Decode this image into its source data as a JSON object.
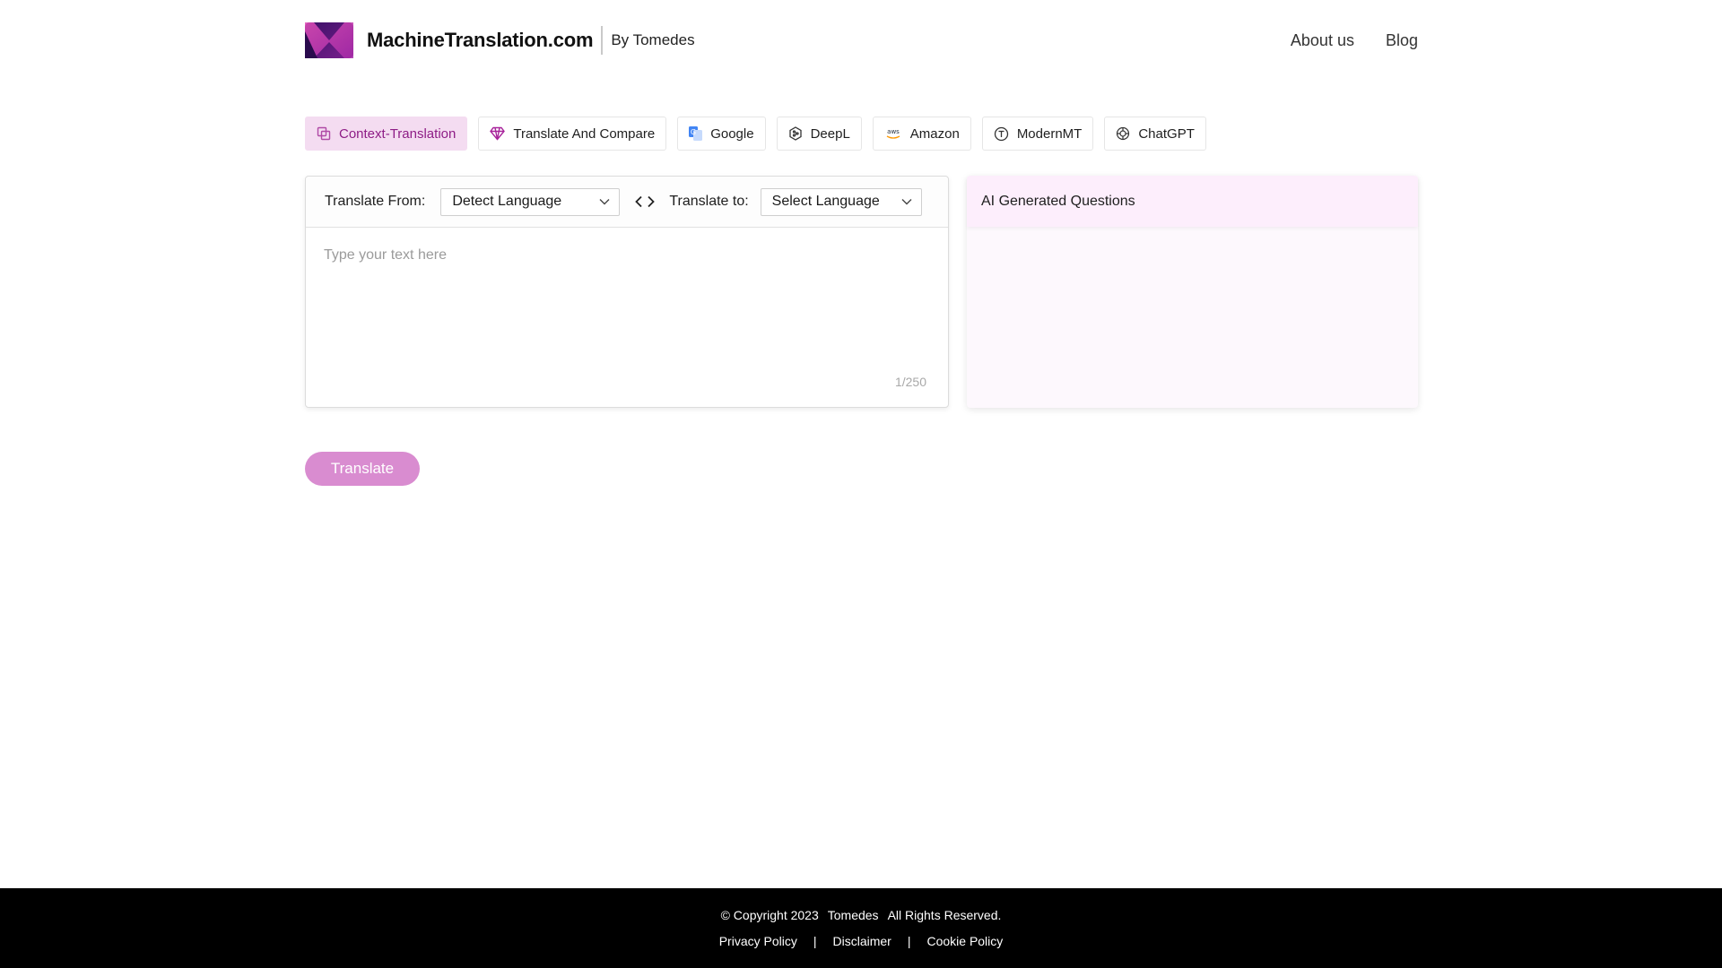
{
  "header": {
    "brand_name": "MachineTranslation.com",
    "brand_by": "By Tomedes",
    "nav": [
      "About us",
      "Blog"
    ]
  },
  "tabs": [
    {
      "label": "Context-Translation",
      "icon": "copy-icon",
      "active": true
    },
    {
      "label": "Translate And Compare",
      "icon": "diamond-icon"
    },
    {
      "label": "Google",
      "icon": "google-translate-icon"
    },
    {
      "label": "DeepL",
      "icon": "deepl-icon"
    },
    {
      "label": "Amazon",
      "icon": "aws-icon"
    },
    {
      "label": "ModernMT",
      "icon": "modernmt-icon"
    },
    {
      "label": "ChatGPT",
      "icon": "chatgpt-icon"
    }
  ],
  "translator": {
    "from_label": "Translate From:",
    "from_value": "Detect Language",
    "to_label": "Translate to:",
    "to_value": "Select Language",
    "placeholder": "Type your text here",
    "counter": "1/250"
  },
  "ai_panel": {
    "title": "AI Generated Questions"
  },
  "translate_button": "Translate",
  "footer": {
    "copyright": "© Copyright 2023",
    "company": "Tomedes",
    "rights": "All Rights Reserved.",
    "links": [
      "Privacy Policy",
      "Disclaimer",
      "Cookie Policy"
    ],
    "separator": "|"
  },
  "colors": {
    "accent": "#8e1d86",
    "tab_active_bg": "#f4dcf1",
    "button": "#d98cd0",
    "ai_header_bg": "#fdeefc",
    "footer_bg": "#000000"
  }
}
